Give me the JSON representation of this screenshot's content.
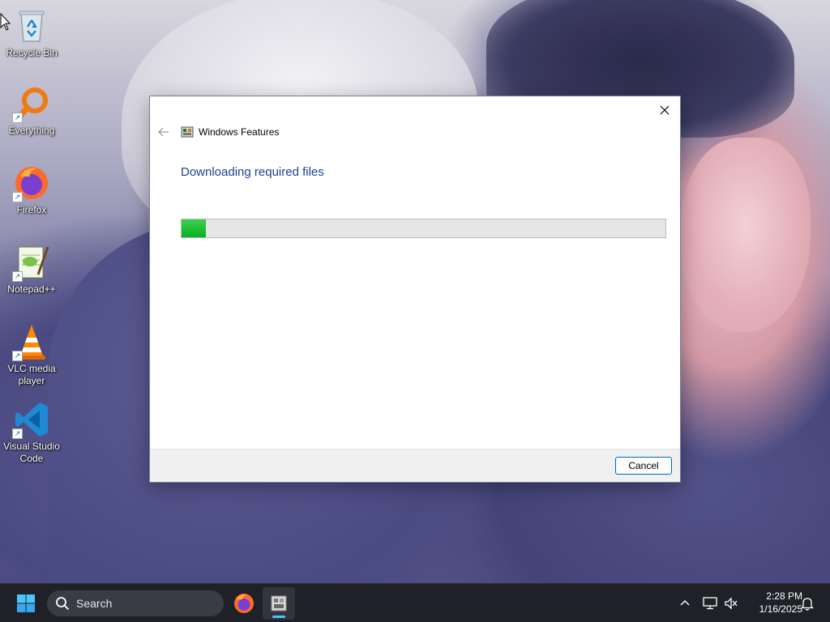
{
  "desktop": {
    "icons": [
      {
        "label": "Recycle Bin",
        "icon": "recycle-bin-icon"
      },
      {
        "label": "Everything",
        "icon": "everything-search-icon"
      },
      {
        "label": "Firefox",
        "icon": "firefox-icon"
      },
      {
        "label": "Notepad++",
        "icon": "notepad-plus-plus-icon"
      },
      {
        "label": "VLC media player",
        "icon": "vlc-icon"
      },
      {
        "label": "Visual Studio Code",
        "icon": "vscode-icon"
      }
    ]
  },
  "dialog": {
    "window_title": "Windows Features",
    "heading": "Downloading required files",
    "progress_percent": 5,
    "cancel_label": "Cancel",
    "colors": {
      "heading": "#1c3f95",
      "progress": "#06b025",
      "accent": "#0067c0"
    }
  },
  "taskbar": {
    "search_placeholder": "Search",
    "clock_time": "2:28 PM",
    "clock_date": "1/16/2025",
    "pinned": [
      {
        "name": "firefox",
        "icon": "firefox-icon"
      },
      {
        "name": "windows-features",
        "icon": "windows-features-icon",
        "active": true
      }
    ],
    "tray": [
      "chevron-up-icon",
      "network-icon",
      "volume-muted-icon",
      "notification-bell-icon"
    ]
  }
}
